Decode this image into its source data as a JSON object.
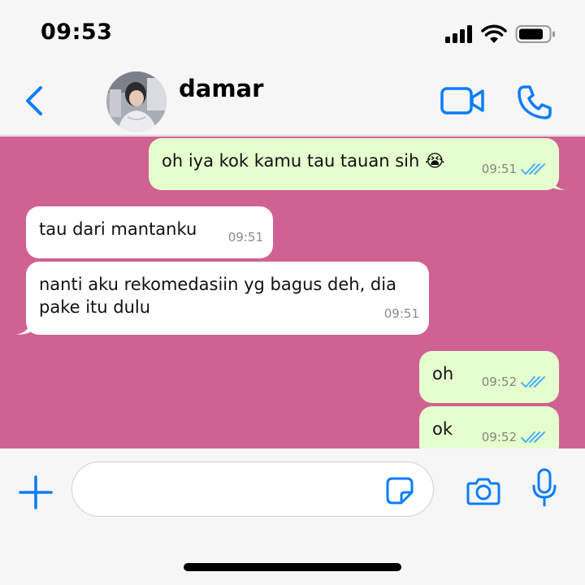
{
  "status_bar": {
    "time": "09:53",
    "icons": [
      "signal-icon",
      "wifi-icon",
      "battery-icon"
    ]
  },
  "header": {
    "contact_name": "damar",
    "icons": [
      "back-chevron-icon",
      "avatar",
      "video-camera-icon",
      "phone-icon"
    ]
  },
  "chat": {
    "background_color": "#cf6293",
    "messages": [
      {
        "direction": "outgoing",
        "text": "oh iya kok kamu tau tauan sih 😭",
        "time": "09:51",
        "read": true
      },
      {
        "direction": "incoming",
        "text": "tau dari mantanku",
        "time": "09:51"
      },
      {
        "direction": "incoming",
        "text": "nanti aku rekomedasiin yg bagus deh, dia pake itu dulu",
        "time": "09:51"
      },
      {
        "direction": "outgoing",
        "text": "oh",
        "time": "09:52",
        "read": true
      },
      {
        "direction": "outgoing",
        "text": "ok",
        "time": "09:52",
        "read": true
      }
    ]
  },
  "input_bar": {
    "placeholder": "",
    "icons": [
      "plus-icon",
      "sticker-icon",
      "camera-icon",
      "microphone-icon"
    ]
  },
  "colors": {
    "accent": "#0a7cff",
    "outgoing_bubble": "#e6ffcf",
    "incoming_bubble": "#ffffff",
    "read_ticks": "#4fb0f6"
  }
}
